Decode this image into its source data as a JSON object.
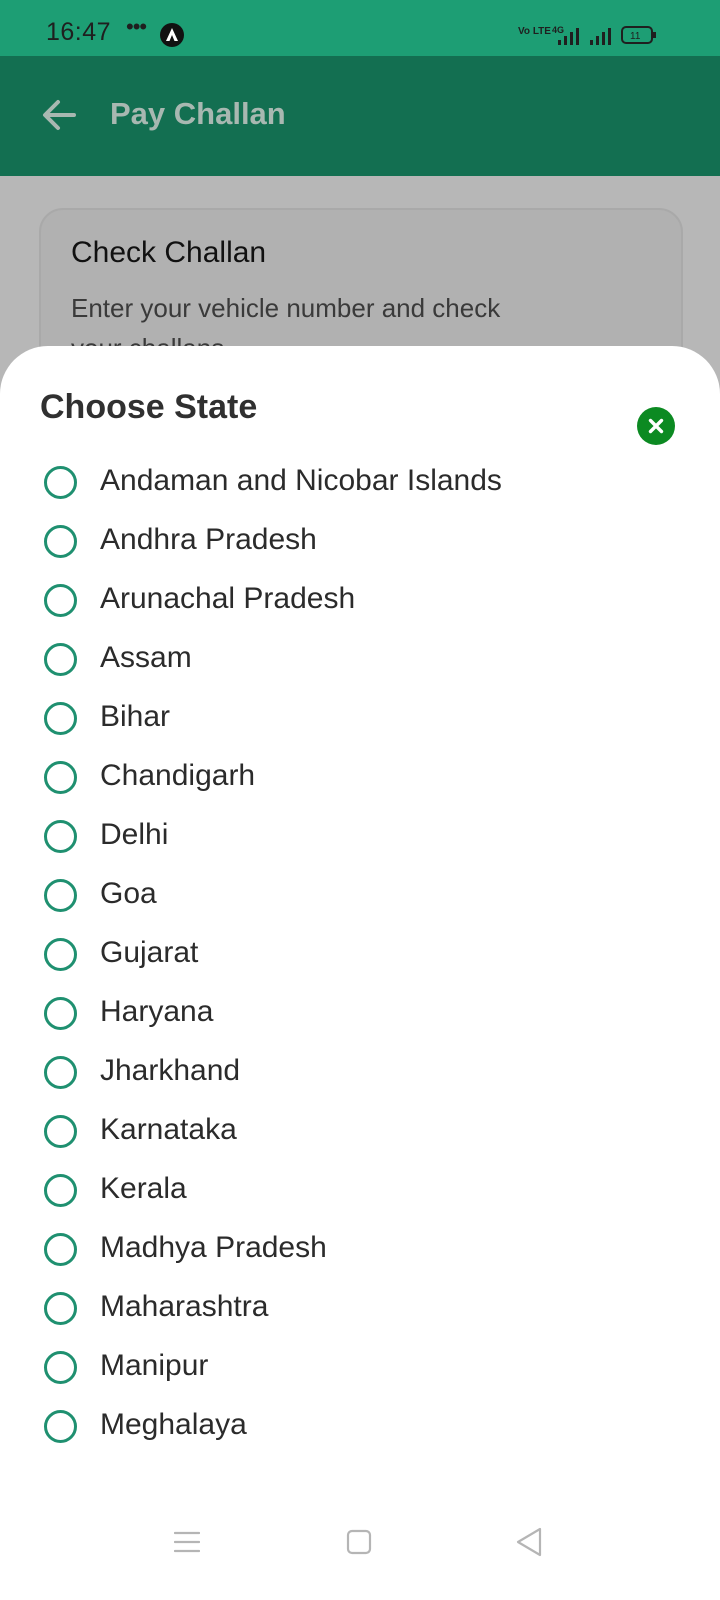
{
  "status_bar": {
    "time": "16:47",
    "dots": "•••",
    "battery": "11",
    "network_label": "Vo LTE",
    "network_type": "4G",
    "icons": [
      "app-notification-icon",
      "volte-icon",
      "signal-4g-icon",
      "signal-icon",
      "battery-icon"
    ]
  },
  "app_bar": {
    "title": "Pay Challan",
    "back_icon": "back-arrow-icon"
  },
  "background_card": {
    "title": "Check Challan",
    "description": "Enter your vehicle number and check your challans"
  },
  "sheet": {
    "title": "Choose State",
    "close_icon": "close-icon",
    "states": [
      "Andaman and Nicobar Islands",
      "Andhra Pradesh",
      "Arunachal Pradesh",
      "Assam",
      "Bihar",
      "Chandigarh",
      "Delhi",
      "Goa",
      "Gujarat",
      "Haryana",
      "Jharkhand",
      "Karnataka",
      "Kerala",
      "Madhya Pradesh",
      "Maharashtra",
      "Manipur",
      "Meghalaya"
    ]
  },
  "nav_bar": {
    "icons": [
      "menu-icon",
      "home-icon",
      "back-icon"
    ]
  },
  "colors": {
    "status_bar": "#1d9e74",
    "app_bar": "#136f51",
    "radio_border": "#1f9070",
    "close_button": "#0c8a22",
    "scrim": "#b7b7b7"
  }
}
